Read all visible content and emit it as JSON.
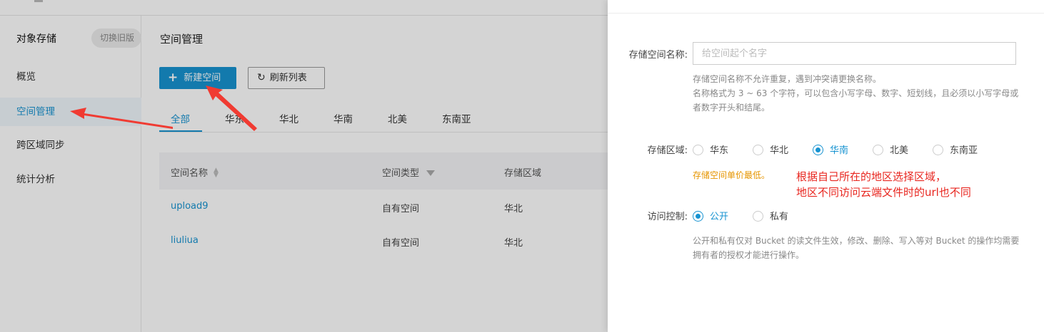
{
  "sidebar": {
    "title": "对象存储",
    "old_version_button": "切换旧版",
    "items": [
      {
        "label": "概览"
      },
      {
        "label": "空间管理"
      },
      {
        "label": "跨区域同步"
      },
      {
        "label": "统计分析"
      }
    ]
  },
  "main": {
    "page_title": "空间管理",
    "new_button": "新建空间",
    "refresh_button": "刷新列表",
    "tabs": [
      "全部",
      "华东",
      "华北",
      "华南",
      "北美",
      "东南亚"
    ],
    "table": {
      "headers": [
        "空间名称",
        "空间类型",
        "存储区域"
      ],
      "rows": [
        [
          "upload9",
          "自有空间",
          "华北"
        ],
        [
          "liuliua",
          "自有空间",
          "华北"
        ]
      ]
    }
  },
  "drawer": {
    "name_label": "存储空间名称:",
    "name_placeholder": "给空间起个名字",
    "name_hint_1": "存储空间名称不允许重复，遇到冲突请更换名称。",
    "name_hint_2": "名称格式为 3 ~ 63 个字符，可以包含小写字母、数字、短划线，且必须以小写字母或",
    "name_hint_3": "者数字开头和结尾。",
    "region_label": "存储区域:",
    "regions": [
      "华东",
      "华北",
      "华南",
      "北美",
      "东南亚"
    ],
    "region_selected": "华南",
    "price_note": "存储空间单价最低。",
    "annotation_line1": "根据自己所在的地区选择区域，",
    "annotation_line2": "地区不同访问云端文件时的url也不同",
    "access_label": "访问控制:",
    "access_options": [
      "公开",
      "私有"
    ],
    "access_selected": "公开",
    "access_hint_1": "公开和私有仅对 Bucket 的读文件生效，修改、删除、写入等对 Bucket 的操作均需要",
    "access_hint_2": "拥有者的授权才能进行操作。"
  },
  "colors": {
    "accent": "#1793d1",
    "annotation": "#e8261f",
    "price_note": "#e69500"
  }
}
